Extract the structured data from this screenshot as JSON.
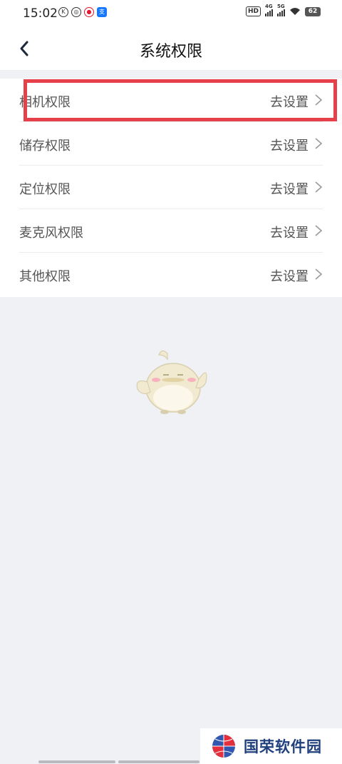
{
  "status_bar": {
    "time": "15:02",
    "hd_label": "HD",
    "net1": "4G",
    "net2": "5G",
    "battery": "62"
  },
  "header": {
    "title": "系统权限",
    "back_icon": "chevron-left-icon"
  },
  "permissions": [
    {
      "label": "相机权限",
      "action": "去设置"
    },
    {
      "label": "储存权限",
      "action": "去设置"
    },
    {
      "label": "定位权限",
      "action": "去设置"
    },
    {
      "label": "麦克风权限",
      "action": "去设置"
    },
    {
      "label": "其他权限",
      "action": "去设置"
    }
  ],
  "watermark": {
    "text": "国荣软件园"
  },
  "colors": {
    "highlight": "#e6404a",
    "background": "#eff1f5",
    "watermark_text": "#1f3f7d"
  }
}
